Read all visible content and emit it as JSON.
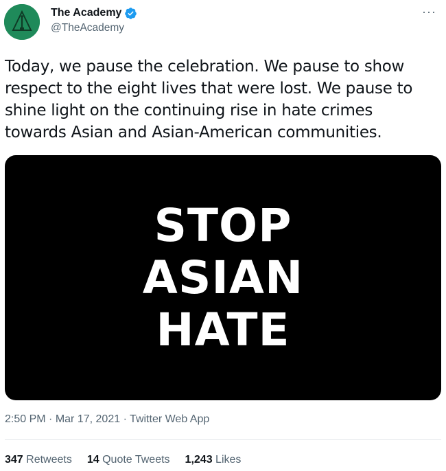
{
  "tweet": {
    "display_name": "The Academy",
    "handle": "@TheAcademy",
    "avatar_icon": "academy-logo-icon",
    "avatar_color": "#1f8a5a",
    "verified_icon": "verified-badge-icon",
    "verified_color": "#1d9bf0",
    "more_icon": "more-options-icon",
    "more_label": "···",
    "text_lines": [
      "Today, we pause the celebration. We pause to show",
      "respect to the eight lives that were lost. We pause to",
      "shine light on the continuing rise in hate crimes",
      "towards Asian and Asian-American communities."
    ],
    "media": {
      "lines": [
        "STOP",
        "ASIAN",
        "HATE"
      ],
      "background": "#000000",
      "text_color": "#ffffff"
    },
    "time": "2:50 PM",
    "date": "Mar 17, 2021",
    "source": "Twitter Web App",
    "separator": "·",
    "stats": {
      "retweets_count": "347",
      "retweets_label": "Retweets",
      "quote_count": "14",
      "quote_label": "Quote Tweets",
      "likes_count": "1,243",
      "likes_label": "Likes"
    }
  }
}
